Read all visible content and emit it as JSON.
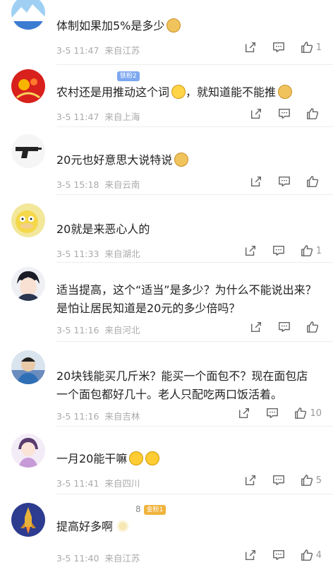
{
  "comments": [
    {
      "avatar": "mountain-lake-avatar",
      "name": "",
      "badge": "",
      "text": "体制如果加5%是多少",
      "emoji": "doge",
      "date": "3-5 11:47",
      "location": "来自江苏",
      "likes": "1"
    },
    {
      "avatar": "red-pattern-avatar",
      "name": "",
      "badge": "铁粉2",
      "text": "农村还是用推动这个词",
      "emoji": "cry-laugh",
      "text2": "，就知道能不能推",
      "emoji2": "doge",
      "date": "3-5 11:47",
      "location": "来自上海",
      "likes": ""
    },
    {
      "avatar": "pistol-avatar",
      "name": "",
      "badge": "",
      "text": "20元也好意思大说特说",
      "emoji": "doge",
      "date": "3-5 15:18",
      "location": "来自云南",
      "likes": ""
    },
    {
      "avatar": "psyduck-avatar",
      "name": "",
      "badge": "",
      "text": "20就是来恶心人的",
      "emoji": "",
      "date": "3-5 11:33",
      "location": "来自湖北",
      "likes": "1"
    },
    {
      "avatar": "anime-boy-avatar",
      "name": "",
      "badge": "",
      "text": "适当提高，这个“适当”是多少？为什么不能说出来？是怕让居民知道是20元的多少倍吗？",
      "emoji": "",
      "date": "3-5 11:16",
      "location": "来自河北",
      "likes": ""
    },
    {
      "avatar": "man-photo-avatar",
      "name": "",
      "badge": "",
      "text": "20块钱能买几斤米？能买一个面包不？现在面包店一个面包都好几十。老人只配吃两口饭活着。",
      "emoji": "",
      "date": "3-5 11:16",
      "location": "来自吉林",
      "likes": "10"
    },
    {
      "avatar": "doll-avatar",
      "name": "",
      "badge": "",
      "text": "一月20能干嘛",
      "emoji": "laugh-laugh",
      "date": "3-5 11:41",
      "location": "来自四川",
      "likes": "5"
    },
    {
      "avatar": "rocket-avatar",
      "name": "8",
      "badge": "金粉1",
      "text": "提高好多啊",
      "emoji": "gold",
      "date": "3-5 11:40",
      "location": "来自江苏",
      "likes": "4"
    }
  ],
  "icons": {
    "share": "share-icon",
    "reply": "comment-icon",
    "like": "thumbs-up-icon"
  }
}
